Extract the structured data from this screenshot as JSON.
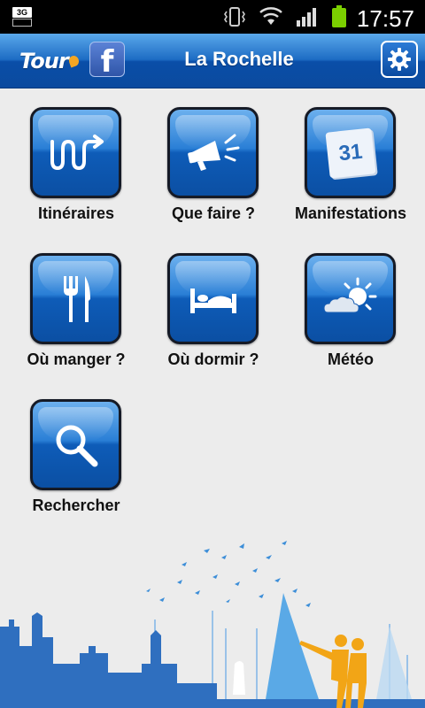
{
  "status_bar": {
    "network": "3G",
    "time": "17:57",
    "icons": [
      "vibrate-icon",
      "wifi-icon",
      "signal-icon",
      "battery-icon"
    ]
  },
  "app_bar": {
    "logo_text": "Tour",
    "facebook_label": "f",
    "title": "La Rochelle",
    "settings_icon": "gear-icon"
  },
  "menu": {
    "items": [
      {
        "label": "Itinéraires",
        "icon": "route-icon"
      },
      {
        "label": "Que faire ?",
        "icon": "megaphone-icon"
      },
      {
        "label": "Manifestations",
        "icon": "calendar-icon",
        "calendar_day": "31"
      },
      {
        "label": "Où manger ?",
        "icon": "fork-knife-icon"
      },
      {
        "label": "Où dormir ?",
        "icon": "bed-icon"
      },
      {
        "label": "Météo",
        "icon": "weather-icon"
      },
      {
        "label": "Rechercher",
        "icon": "search-icon"
      }
    ]
  },
  "colors": {
    "accent": "#0b4fa3",
    "brand_orange": "#f5a623",
    "skyline_blue": "#2f6fbf"
  }
}
